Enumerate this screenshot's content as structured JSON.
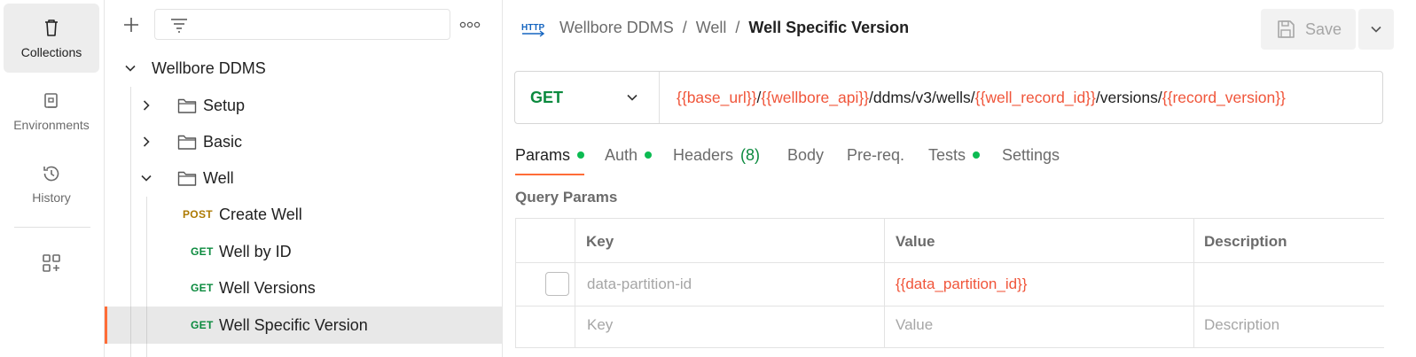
{
  "rail": {
    "items": [
      {
        "label": "Collections",
        "icon": "trash-can-icon",
        "active": true
      },
      {
        "label": "Environments",
        "icon": "environment-icon",
        "active": false
      },
      {
        "label": "History",
        "icon": "history-icon",
        "active": false
      }
    ],
    "extra_icon": "add-widgets-icon"
  },
  "sidebar": {
    "tree": [
      {
        "label": "Wellbore DDMS",
        "kind": "collection",
        "expanded": true
      },
      {
        "label": "Setup",
        "kind": "folder",
        "expanded": false
      },
      {
        "label": "Basic",
        "kind": "folder",
        "expanded": false
      },
      {
        "label": "Well",
        "kind": "folder",
        "expanded": true
      },
      {
        "label": "Create Well",
        "kind": "request",
        "method": "POST"
      },
      {
        "label": "Well by ID",
        "kind": "request",
        "method": "GET"
      },
      {
        "label": "Well Versions",
        "kind": "request",
        "method": "GET"
      },
      {
        "label": "Well Specific Version",
        "kind": "request",
        "method": "GET",
        "selected": true
      }
    ]
  },
  "header": {
    "breadcrumb": [
      "Wellbore DDMS",
      "/",
      "Well",
      "/",
      "Well Specific Version"
    ],
    "save_label": "Save"
  },
  "request": {
    "method": "GET",
    "url_parts": [
      {
        "text": "{{base_url}}",
        "var": true
      },
      {
        "text": "/",
        "var": false
      },
      {
        "text": "{{wellbore_api}}",
        "var": true
      },
      {
        "text": "/ddms/v3/wells/",
        "var": false
      },
      {
        "text": "{{well_record_id}}",
        "var": true
      },
      {
        "text": "/versions/",
        "var": false
      },
      {
        "text": "{{record_version}}",
        "var": true
      }
    ]
  },
  "tabs": [
    {
      "label": "Params",
      "dot": true,
      "active": true
    },
    {
      "label": "Auth",
      "dot": true
    },
    {
      "label": "Headers",
      "count": "(8)"
    },
    {
      "label": "Body"
    },
    {
      "label": "Pre-req."
    },
    {
      "label": "Tests",
      "dot": true
    },
    {
      "label": "Settings"
    }
  ],
  "query_params": {
    "title": "Query Params",
    "columns": [
      "Key",
      "Value",
      "Description"
    ],
    "rows": [
      {
        "key": "data-partition-id",
        "value": "{{data_partition_id}}",
        "description": ""
      }
    ],
    "placeholder": {
      "key": "Key",
      "value": "Value",
      "description": "Description"
    }
  },
  "colors": {
    "accent": "#ff6c37",
    "get": "#0b8a3e",
    "post": "#ad7a03",
    "variable": "#f0553a",
    "dot": "#0cbb52"
  }
}
